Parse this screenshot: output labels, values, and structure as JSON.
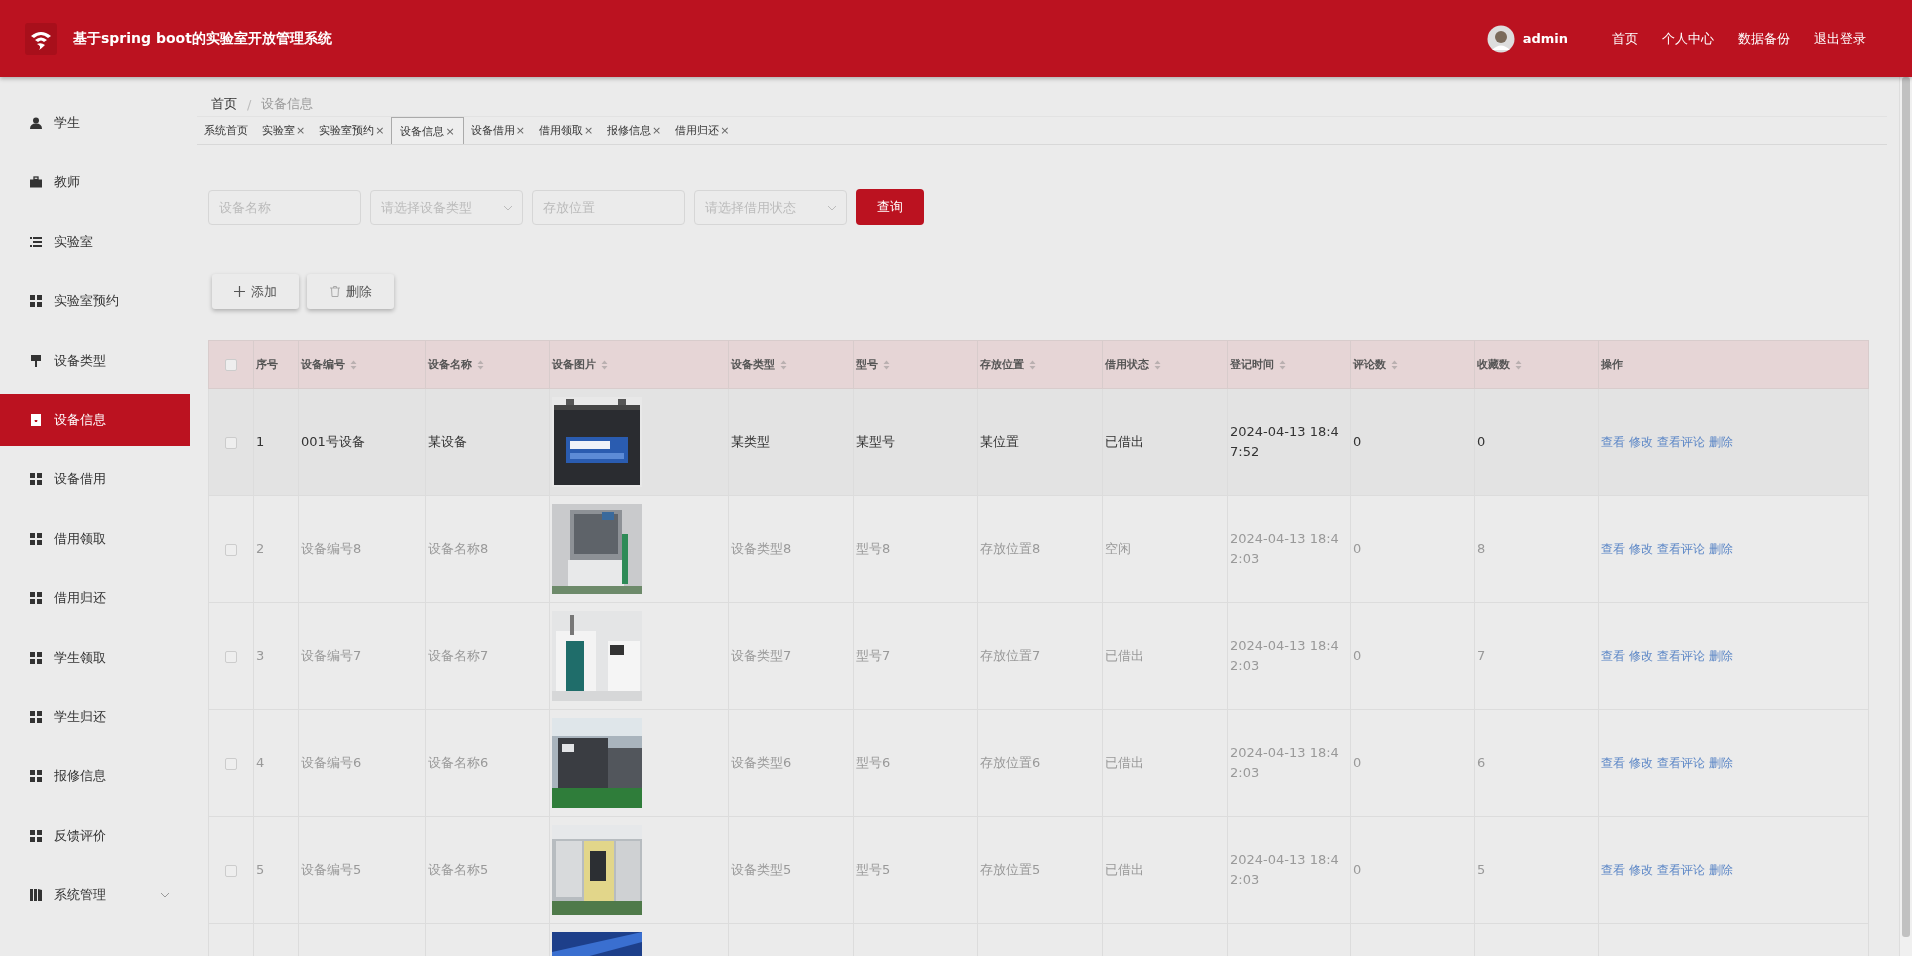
{
  "header": {
    "title": "基于spring boot的实验室开放管理系统",
    "user": "admin",
    "links": [
      "首页",
      "个人中心",
      "数据备份",
      "退出登录"
    ]
  },
  "sidebar": {
    "items": [
      {
        "label": "学生",
        "selected": false
      },
      {
        "label": "教师",
        "selected": false
      },
      {
        "label": "实验室",
        "selected": false
      },
      {
        "label": "实验室预约",
        "selected": false
      },
      {
        "label": "设备类型",
        "selected": false
      },
      {
        "label": "设备信息",
        "selected": true
      },
      {
        "label": "设备借用",
        "selected": false
      },
      {
        "label": "借用领取",
        "selected": false
      },
      {
        "label": "借用归还",
        "selected": false
      },
      {
        "label": "学生领取",
        "selected": false
      },
      {
        "label": "学生归还",
        "selected": false
      },
      {
        "label": "报修信息",
        "selected": false
      },
      {
        "label": "反馈评价",
        "selected": false
      },
      {
        "label": "系统管理",
        "selected": false,
        "expanded": false
      }
    ]
  },
  "breadcrumb": [
    "首页",
    "/",
    "设备信息"
  ],
  "tabs": [
    {
      "label": "系统首页",
      "selected": false
    },
    {
      "label": "实验室",
      "close": "×",
      "selected": false
    },
    {
      "label": "实验室预约",
      "close": "×",
      "selected": false
    },
    {
      "label": "设备信息",
      "close": "×",
      "selected": true
    },
    {
      "label": "设备借用",
      "close": "×",
      "selected": false
    },
    {
      "label": "借用领取",
      "close": "×",
      "selected": false
    },
    {
      "label": "报修信息",
      "close": "×",
      "selected": false
    },
    {
      "label": "借用归还",
      "close": "×",
      "selected": false
    }
  ],
  "search": {
    "fields": [
      {
        "kind": "input",
        "placeholder": "设备名称"
      },
      {
        "kind": "select",
        "placeholder": "请选择设备类型"
      },
      {
        "kind": "input",
        "placeholder": "存放位置"
      },
      {
        "kind": "select",
        "placeholder": "请选择借用状态"
      }
    ],
    "button": "查询"
  },
  "actions": [
    {
      "kind": "add",
      "label": "添加"
    },
    {
      "kind": "delete",
      "label": "删除"
    }
  ],
  "table": {
    "select_all": {
      "checked": false
    },
    "columns": [
      {
        "label": "序号",
        "sortable": false
      },
      {
        "label": "设备编号",
        "sortable": true
      },
      {
        "label": "设备名称",
        "sortable": true
      },
      {
        "label": "设备图片",
        "sortable": true
      },
      {
        "label": "设备类型",
        "sortable": true
      },
      {
        "label": "型号",
        "sortable": true
      },
      {
        "label": "存放位置",
        "sortable": true
      },
      {
        "label": "借用状态",
        "sortable": true
      },
      {
        "label": "登记时间",
        "sortable": true
      },
      {
        "label": "评论数",
        "sortable": true
      },
      {
        "label": "收藏数",
        "sortable": true
      },
      {
        "label": "操作",
        "sortable": false
      }
    ],
    "rows": [
      {
        "checked": false,
        "hovered": true,
        "cells": [
          "1",
          "001号设备",
          "某设备"
        ],
        "image": {
          "kind": "picture"
        },
        "rest": [
          "某类型",
          "某型号",
          "某位置",
          "已借出",
          "2024-04-13 18:47:52",
          "0",
          "0"
        ],
        "links": [
          "查看",
          "修改",
          "查看评论",
          "删除"
        ]
      },
      {
        "checked": false,
        "hovered": false,
        "cells": [
          "2",
          "设备编号8",
          "设备名称8"
        ],
        "image": {
          "kind": "picture"
        },
        "rest": [
          "设备类型8",
          "型号8",
          "存放位置8",
          "空闲",
          "2024-04-13 18:42:03",
          "0",
          "8"
        ],
        "links": [
          "查看",
          "修改",
          "查看评论",
          "删除"
        ]
      },
      {
        "checked": false,
        "hovered": false,
        "cells": [
          "3",
          "设备编号7",
          "设备名称7"
        ],
        "image": {
          "kind": "picture"
        },
        "rest": [
          "设备类型7",
          "型号7",
          "存放位置7",
          "已借出",
          "2024-04-13 18:42:03",
          "0",
          "7"
        ],
        "links": [
          "查看",
          "修改",
          "查看评论",
          "删除"
        ]
      },
      {
        "checked": false,
        "hovered": false,
        "cells": [
          "4",
          "设备编号6",
          "设备名称6"
        ],
        "image": {
          "kind": "picture"
        },
        "rest": [
          "设备类型6",
          "型号6",
          "存放位置6",
          "已借出",
          "2024-04-13 18:42:03",
          "0",
          "6"
        ],
        "links": [
          "查看",
          "修改",
          "查看评论",
          "删除"
        ]
      },
      {
        "checked": false,
        "hovered": false,
        "cells": [
          "5",
          "设备编号5",
          "设备名称5"
        ],
        "image": {
          "kind": "picture"
        },
        "rest": [
          "设备类型5",
          "型号5",
          "存放位置5",
          "已借出",
          "2024-04-13 18:42:03",
          "0",
          "5"
        ],
        "links": [
          "查看",
          "修改",
          "查看评论",
          "删除"
        ]
      }
    ],
    "cut_row": {
      "image": {
        "kind": "picture"
      }
    }
  }
}
